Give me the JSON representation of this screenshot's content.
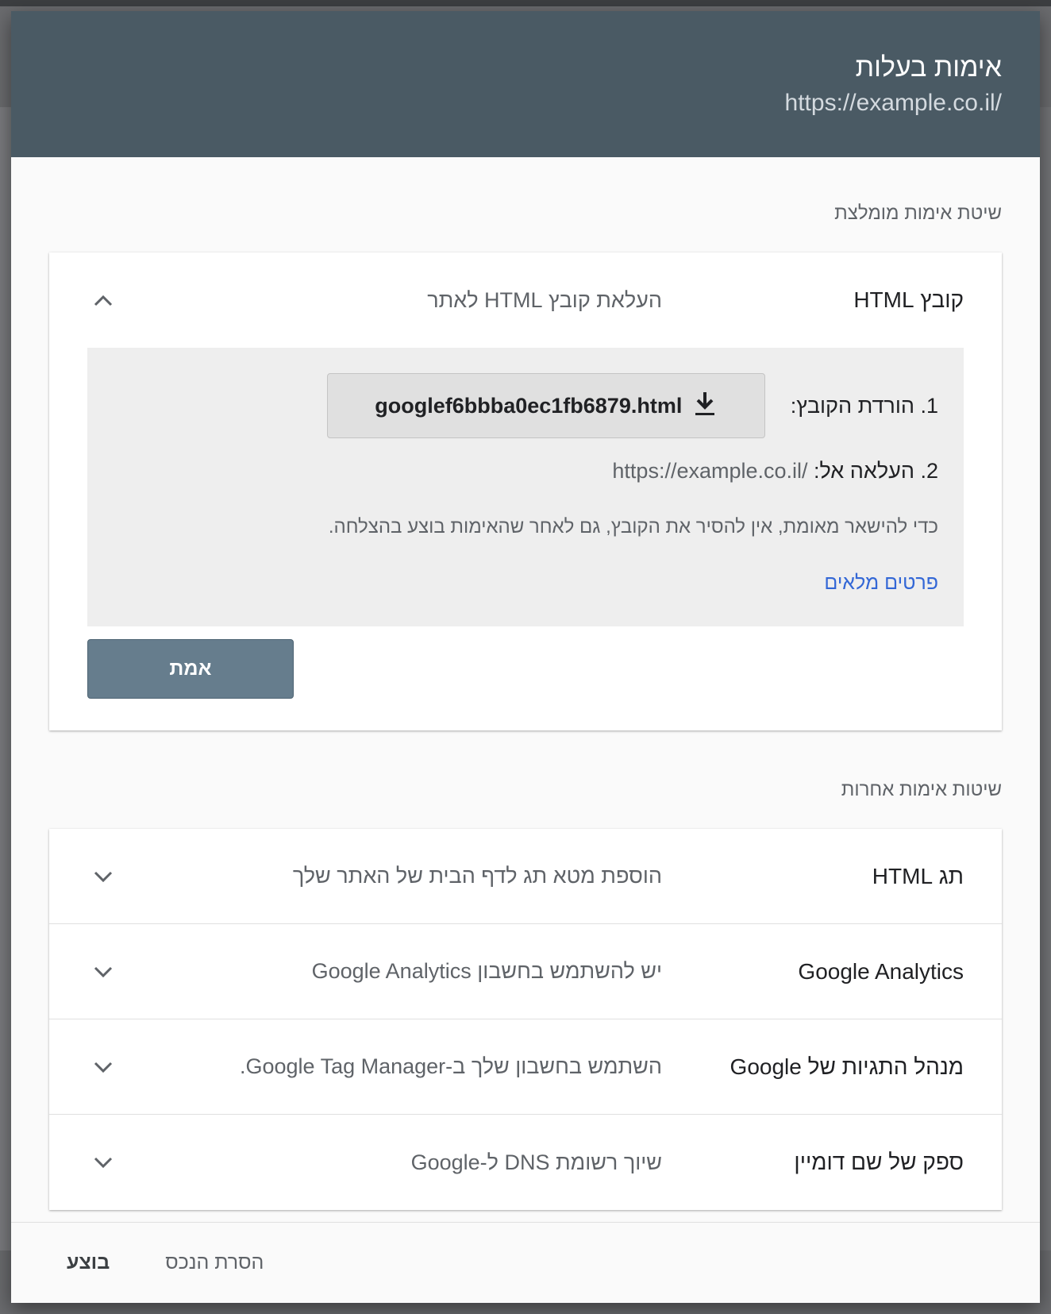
{
  "dialog": {
    "title": "אימות בעלות",
    "subtitle": "https://example.co.il/"
  },
  "recommended": {
    "section_label": "שיטת אימות מומלצת",
    "method": {
      "name": "קובץ HTML",
      "description": "העלאת קובץ HTML לאתר",
      "expanded_icon": "chevron-up-icon"
    },
    "step1_label": "1. הורדת הקובץ:",
    "download_filename": "googlef6bbba0ec1fb6879.html",
    "download_icon": "download-icon",
    "step2_label": "2. העלאה אל:",
    "upload_url": "https://example.co.il/",
    "note": "כדי להישאר מאומת, אין להסיר את הקובץ, גם לאחר שהאימות בוצע בהצלחה.",
    "details_link": "פרטים מלאים",
    "verify_button": "אמת"
  },
  "others": {
    "section_label": "שיטות אימות אחרות",
    "items": [
      {
        "name": "תג HTML",
        "description": "הוספת מטא תג לדף הבית של האתר שלך"
      },
      {
        "name": "Google Analytics",
        "description": "יש להשתמש בחשבון Google Analytics"
      },
      {
        "name": "מנהל התגיות של Google",
        "description": "השתמש בחשבון שלך ב-Google Tag Manager."
      },
      {
        "name": "ספק של שם דומיין",
        "description": "שיוך רשומת DNS ל-Google"
      }
    ]
  },
  "footer": {
    "remove_button": "הסרת הנכס",
    "done_button": "בוצע"
  },
  "colors": {
    "header_bg": "#4a5a64",
    "verify_bg": "#667d8d",
    "link": "#3367d6"
  }
}
